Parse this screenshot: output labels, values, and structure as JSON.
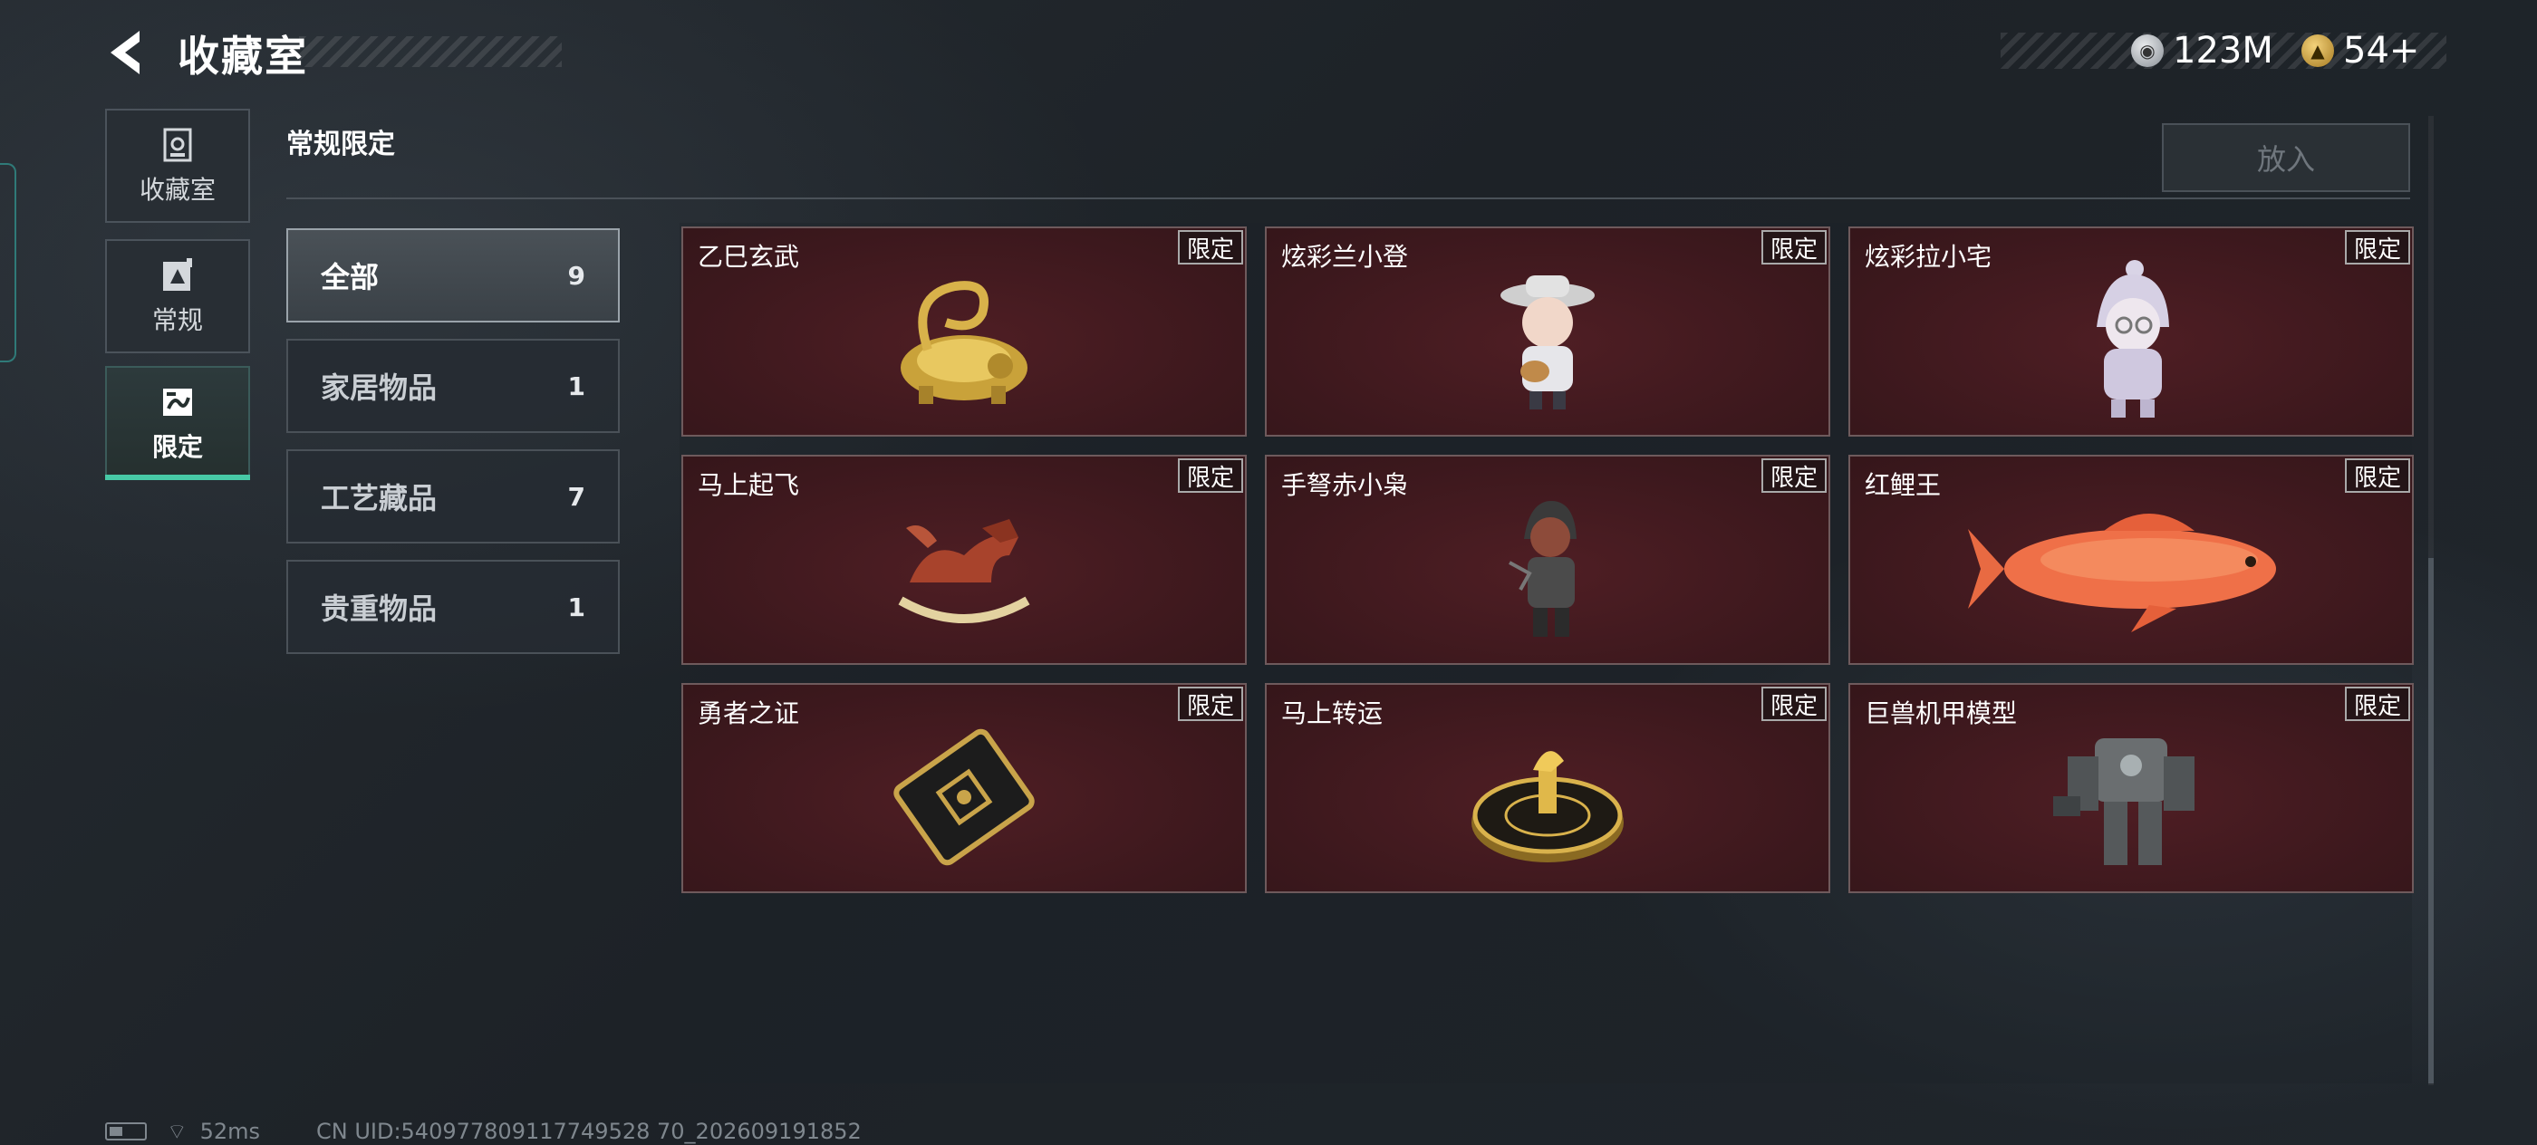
{
  "header": {
    "title": "收藏室",
    "currencies": [
      {
        "icon": "silver-coin-icon",
        "value": "123M"
      },
      {
        "icon": "gold-ticket-icon",
        "value": "54+"
      }
    ]
  },
  "side_nav": [
    {
      "label": "收藏室",
      "icon": "collection-room-icon"
    },
    {
      "label": "常规",
      "icon": "regular-icon"
    },
    {
      "label": "限定",
      "icon": "limited-icon",
      "selected": true
    }
  ],
  "section": {
    "title": "常规限定",
    "put_in_label": "放入"
  },
  "filters": [
    {
      "label": "全部",
      "count": "9",
      "active": true
    },
    {
      "label": "家居物品",
      "count": "1"
    },
    {
      "label": "工艺藏品",
      "count": "7"
    },
    {
      "label": "贵重物品",
      "count": "1"
    }
  ],
  "items": [
    {
      "name": "乙巳玄武",
      "badge": "限定",
      "art": "gold-dragon-turtle-icon"
    },
    {
      "name": "炫彩兰小登",
      "badge": "限定",
      "art": "mariachi-doll-icon"
    },
    {
      "name": "炫彩拉小宅",
      "badge": "限定",
      "art": "hooded-doll-icon"
    },
    {
      "name": "马上起飞",
      "badge": "限定",
      "art": "rocking-horse-icon"
    },
    {
      "name": "手弩赤小枭",
      "badge": "限定",
      "art": "crossbow-figure-icon"
    },
    {
      "name": "红鲤王",
      "badge": "限定",
      "art": "red-carp-icon"
    },
    {
      "name": "勇者之证",
      "badge": "限定",
      "art": "hero-card-icon"
    },
    {
      "name": "马上转运",
      "badge": "限定",
      "art": "horse-wheel-icon"
    },
    {
      "name": "巨兽机甲模型",
      "badge": "限定",
      "art": "mech-model-icon"
    }
  ],
  "status": {
    "ping": "52ms",
    "uid": "CN UID:540977809117749528 70_202609191852"
  },
  "colors": {
    "card_bg": "#3c181d",
    "accent": "#47c9a6"
  }
}
